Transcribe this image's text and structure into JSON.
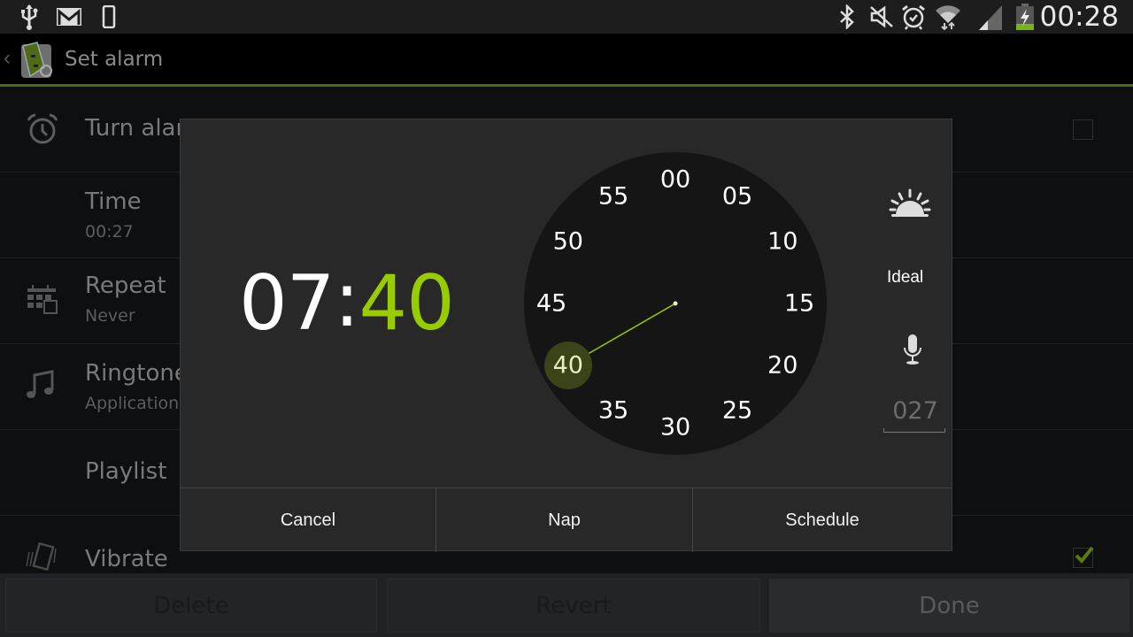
{
  "status_bar": {
    "left_icons": [
      "usb-icon",
      "gmail-icon",
      "phone-icon"
    ],
    "right_icons": [
      "bluetooth-icon",
      "mute-icon",
      "alarm-icon",
      "wifi-icon",
      "signal-icon",
      "battery-charging-icon"
    ],
    "time": "00:28"
  },
  "action_bar": {
    "title": "Set alarm",
    "back_glyph": "‹"
  },
  "settings": [
    {
      "title": "Turn alarm on",
      "title_visible": "Turn alar",
      "subtitle": "",
      "icon": "alarm-clock-icon",
      "checkbox": false
    },
    {
      "title": "Time",
      "subtitle": "00:27",
      "icon": ""
    },
    {
      "title": "Repeat",
      "subtitle": "Never",
      "icon": "calendar-icon"
    },
    {
      "title": "Ringtone",
      "subtitle": "Application",
      "icon": "music-note-icon"
    },
    {
      "title": "Playlist",
      "subtitle": "",
      "icon": ""
    },
    {
      "title": "Vibrate",
      "subtitle": "",
      "icon": "vibrate-icon",
      "checkbox": true
    }
  ],
  "bottom_bar": {
    "delete": "Delete",
    "revert": "Revert",
    "done": "Done"
  },
  "dialog": {
    "hours": "07",
    "separator": ":",
    "minutes": "40",
    "accent_color": "#99cc00",
    "dial_labels": [
      "00",
      "05",
      "10",
      "15",
      "20",
      "25",
      "30",
      "35",
      "40",
      "45",
      "50",
      "55"
    ],
    "selected_minute": 40,
    "side": {
      "sunrise_icon": "sunrise-icon",
      "ideal_label": "Ideal",
      "mic_icon": "microphone-icon",
      "number_value": "027"
    },
    "buttons": {
      "cancel": "Cancel",
      "nap": "Nap",
      "schedule": "Schedule"
    }
  }
}
